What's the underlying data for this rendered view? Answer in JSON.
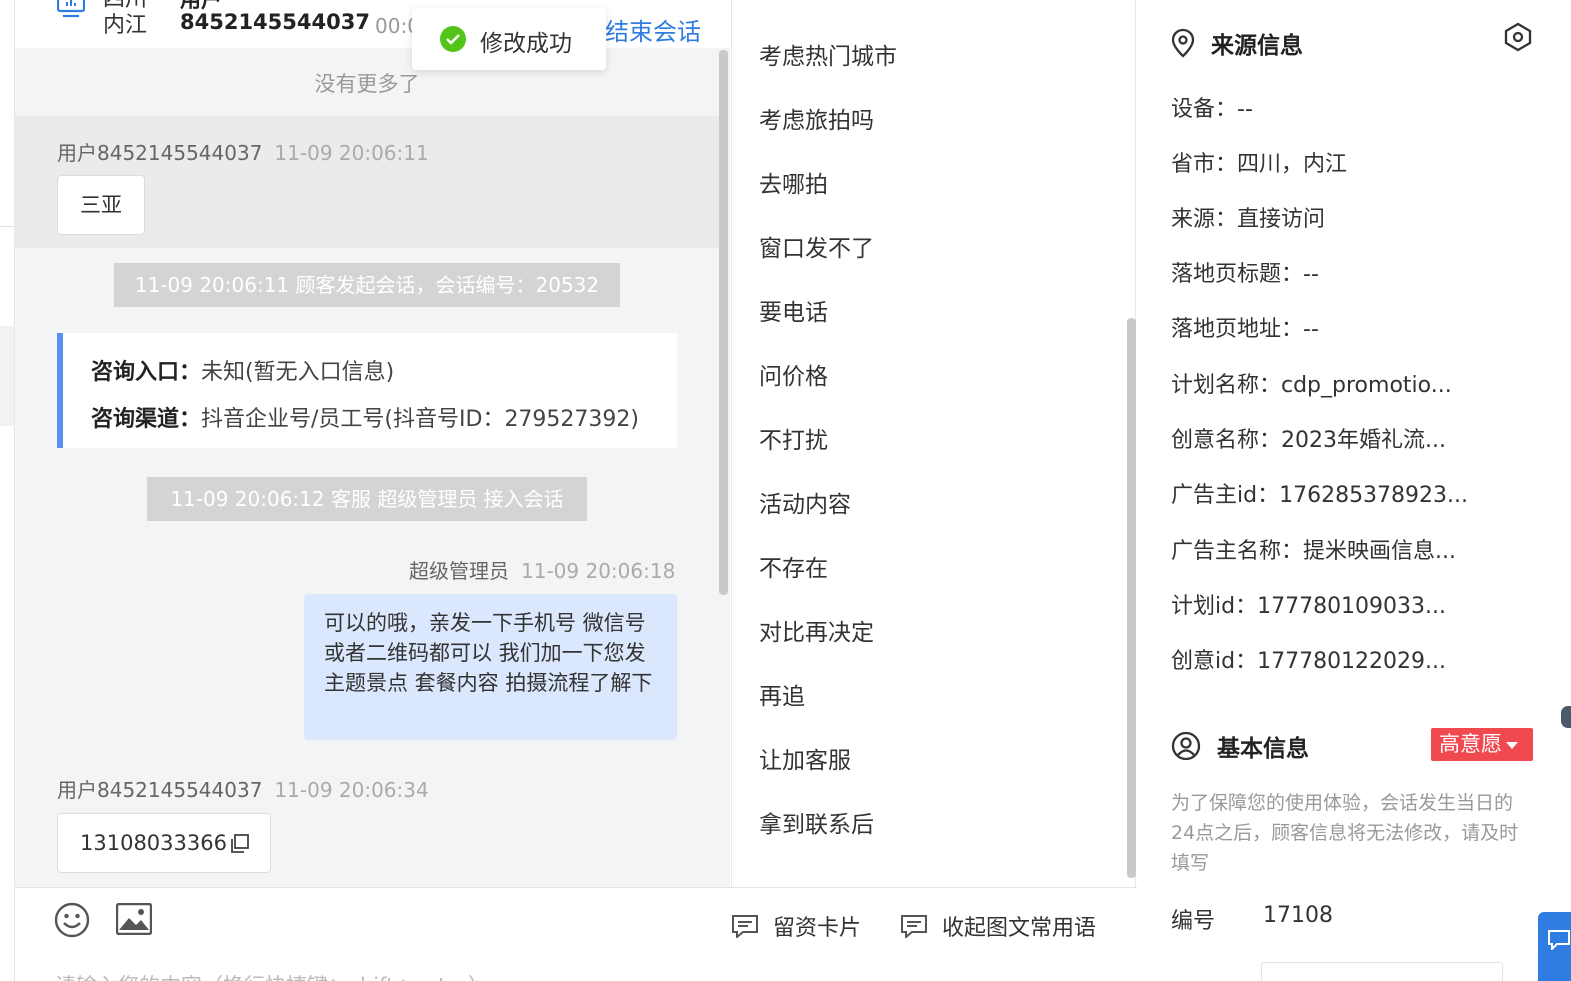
{
  "header": {
    "city_line1": "四川",
    "city_line2": "内江",
    "user_line1": "用户",
    "user_line2": "8452145544037",
    "time_fragment": "00:0",
    "end_session": "结束会话"
  },
  "toast": {
    "text": "修改成功"
  },
  "chat": {
    "no_more": "没有更多了",
    "messages": [
      {
        "sender": "用户8452145544037",
        "time": "11-09 20:06:11",
        "text": "三亚"
      },
      {
        "sender": "超级管理员",
        "time": "11-09 20:06:18",
        "text": "可以的哦，亲发一下手机号 微信号或者二维码都可以 我们加一下您发主题景点 套餐内容 拍摄流程了解下"
      },
      {
        "sender": "用户8452145544037",
        "time": "11-09 20:06:34",
        "text": "13108033366"
      }
    ],
    "system_notes": [
      "11-09 20:06:11 顾客发起会话，会话编号：20532",
      "11-09 20:06:12 客服 超级管理员 接入会话"
    ],
    "info_card": {
      "entry_label": "咨询入口：",
      "entry_value": "未知(暂无入口信息)",
      "channel_label": "咨询渠道：",
      "channel_value": "抖音企业号/员工号(抖音号ID：279527392)"
    }
  },
  "input_bar": {
    "lead_card": "留资卡片",
    "collapse_phrases": "收起图文常用语",
    "placeholder": "请输入您的内容（换行快捷键：shift+enter）"
  },
  "quick_replies": [
    "考虑热门城市",
    "考虑旅拍吗",
    "去哪拍",
    "窗口发不了",
    "要电话",
    "问价格",
    "不打扰",
    "活动内容",
    "不存在",
    "对比再决定",
    "再追",
    "让加客服",
    "拿到联系后"
  ],
  "source_info": {
    "title": "来源信息",
    "rows": [
      "设备：--",
      "省市：四川，内江",
      "来源：直接访问",
      "落地页标题：--",
      "落地页地址：--",
      "计划名称：cdp_promotio...",
      "创意名称：2023年婚礼流...",
      "广告主id：176285378923...",
      "广告主名称：提米映画信息...",
      "计划id：177780109033...",
      "创意id：177780122029..."
    ]
  },
  "basic_info": {
    "title": "基本信息",
    "intent_tag": "高意愿",
    "notice": "为了保障您的使用体验，会话发生当日的24点之后，顾客信息将无法修改，请及时填写",
    "id_label": "编号",
    "id_value": "17108"
  },
  "colors": {
    "accent": "#2f7de1",
    "agent_bubble": "#dbe7fd",
    "tag_red": "#f0494f",
    "success": "#52c41a"
  }
}
